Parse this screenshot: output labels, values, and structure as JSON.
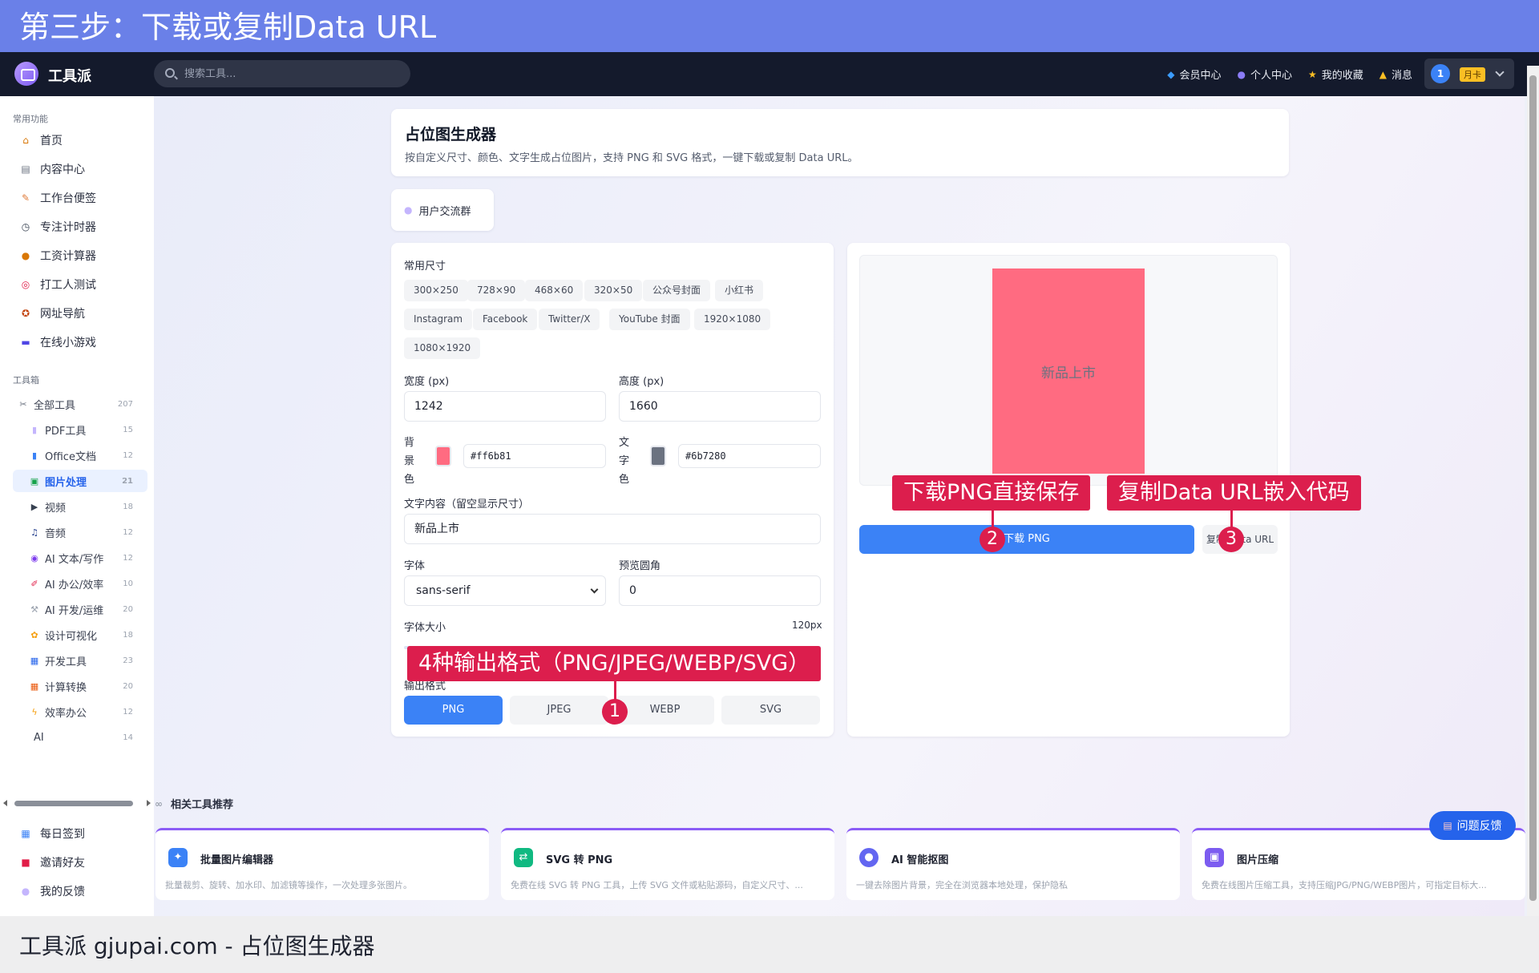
{
  "banner": {
    "title": "第三步：下载或复制Data URL"
  },
  "header": {
    "app_name": "工具派",
    "search_placeholder": "搜索工具...",
    "nav": [
      {
        "label": "会员中心",
        "icon": "diamond-icon"
      },
      {
        "label": "个人中心",
        "icon": "user-icon"
      },
      {
        "label": "我的收藏",
        "icon": "star-icon"
      },
      {
        "label": "消息",
        "icon": "bell-icon"
      }
    ],
    "user_avatar": "1",
    "month_badge": "月卡"
  },
  "sidebar": {
    "common_title": "常用功能",
    "common": [
      {
        "label": "首页",
        "icon": "home-icon"
      },
      {
        "label": "内容中心",
        "icon": "content-icon"
      },
      {
        "label": "工作台便签",
        "icon": "note-icon"
      },
      {
        "label": "专注计时器",
        "icon": "timer-icon"
      },
      {
        "label": "工资计算器",
        "icon": "money-bag-icon"
      },
      {
        "label": "打工人测试",
        "icon": "target-icon"
      },
      {
        "label": "网址导航",
        "icon": "compass-icon"
      },
      {
        "label": "在线小游戏",
        "icon": "gamepad-icon"
      }
    ],
    "toolbox_title": "工具箱",
    "all_tools": {
      "label": "全部工具",
      "count": "207"
    },
    "tools": [
      {
        "label": "PDF工具",
        "count": "15"
      },
      {
        "label": "Office文档",
        "count": "12"
      },
      {
        "label": "图片处理",
        "count": "21"
      },
      {
        "label": "视频",
        "count": "18"
      },
      {
        "label": "音频",
        "count": "12"
      },
      {
        "label": "AI 文本/写作",
        "count": "12"
      },
      {
        "label": "AI 办公/效率",
        "count": "10"
      },
      {
        "label": "AI 开发/运维",
        "count": "20"
      },
      {
        "label": "设计可视化",
        "count": "18"
      },
      {
        "label": "开发工具",
        "count": "23"
      },
      {
        "label": "计算转换",
        "count": "20"
      },
      {
        "label": "效率办公",
        "count": "12"
      },
      {
        "label": "AI",
        "count": "14"
      }
    ],
    "bottom": [
      {
        "label": "每日签到",
        "icon": "calendar-icon"
      },
      {
        "label": "邀请好友",
        "icon": "gift-icon"
      },
      {
        "label": "我的反馈",
        "icon": "chat-icon"
      }
    ]
  },
  "page": {
    "title": "占位图生成器",
    "desc": "按自定义尺寸、颜色、文字生成占位图片，支持 PNG 和 SVG 格式，一键下载或复制 Data URL。",
    "group_label": "用户交流群"
  },
  "form": {
    "sizes_label": "常用尺寸",
    "sizes": [
      "300×250",
      "728×90",
      "468×60",
      "320×50",
      "公众号封面",
      "小红书",
      "Instagram",
      "Facebook",
      "Twitter/X",
      "YouTube 封面",
      "1920×1080",
      "1080×1920"
    ],
    "width_label": "宽度 (px)",
    "width_value": "1242",
    "height_label": "高度 (px)",
    "height_value": "1660",
    "bg_label": [
      "背",
      "景",
      "色"
    ],
    "bg_value": "#ff6b81",
    "fg_label": [
      "文",
      "字",
      "色"
    ],
    "fg_value": "#6b7280",
    "text_label": "文字内容（留空显示尺寸）",
    "text_value": "新品上市",
    "font_label": "字体",
    "font_value": "sans-serif",
    "radius_label": "预览圆角",
    "radius_value": "0",
    "size_label": "字体大小",
    "size_value": "120px",
    "format_label": "输出格式",
    "formats": [
      "PNG",
      "JPEG",
      "WEBP",
      "SVG"
    ],
    "active_format": "PNG"
  },
  "preview": {
    "image_text": "新品上市",
    "download_label": "下载 PNG",
    "copy_label": "复制 Data URL"
  },
  "annotations": {
    "a1": {
      "num": "1",
      "text": "4种输出格式（PNG/JPEG/WEBP/SVG）"
    },
    "a2": {
      "num": "2",
      "text": "下载PNG直接保存"
    },
    "a3": {
      "num": "3",
      "text": "复制Data URL嵌入代码"
    }
  },
  "related": {
    "title": "相关工具推荐",
    "tools": [
      {
        "title": "批量图片编辑器",
        "desc": "批量裁剪、旋转、加水印、加滤镜等操作，一次处理多张图片。",
        "icon": "sparkle-icon",
        "color": "#3b82f6"
      },
      {
        "title": "SVG 转 PNG",
        "desc": "免费在线 SVG 转 PNG 工具，上传 SVG 文件或粘贴源码，自定义尺寸、...",
        "icon": "convert-icon",
        "color": "#10b981"
      },
      {
        "title": "AI 智能抠图",
        "desc": "一键去除图片背景，完全在浏览器本地处理，保护隐私",
        "icon": "person-icon",
        "color": "#6366f1"
      },
      {
        "title": "图片压缩",
        "desc": "免费在线图片压缩工具，支持压缩JPG/PNG/WEBP图片，可指定目标大...",
        "icon": "compress-icon",
        "color": "#7c5cf0"
      }
    ]
  },
  "feedback_label": "问题反馈",
  "caption": "工具派 gjupai.com - 占位图生成器",
  "colors": {
    "accent": "#3b82f6",
    "annotation": "#dc1e4d",
    "preview_bg": "#ff6b81",
    "preview_fg": "#6b7280"
  }
}
